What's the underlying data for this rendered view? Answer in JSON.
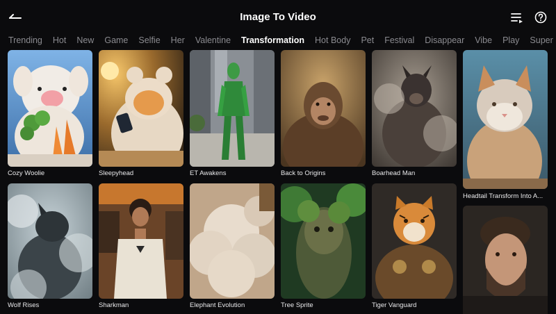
{
  "header": {
    "title": "Image To Video"
  },
  "tabs": [
    {
      "label": "Trending",
      "active": false
    },
    {
      "label": "Hot",
      "active": false
    },
    {
      "label": "New",
      "active": false
    },
    {
      "label": "Game",
      "active": false
    },
    {
      "label": "Selfie",
      "active": false
    },
    {
      "label": "Her",
      "active": false
    },
    {
      "label": "Valentine",
      "active": false
    },
    {
      "label": "Transformation",
      "active": true
    },
    {
      "label": "Hot Body",
      "active": false
    },
    {
      "label": "Pet",
      "active": false
    },
    {
      "label": "Festival",
      "active": false
    },
    {
      "label": "Disappear",
      "active": false
    },
    {
      "label": "Vibe",
      "active": false
    },
    {
      "label": "Play",
      "active": false
    },
    {
      "label": "Super Hero",
      "active": false
    }
  ],
  "cards": [
    {
      "name": "Cozy Woolie"
    },
    {
      "name": "Sleepyhead"
    },
    {
      "name": "ET Awakens"
    },
    {
      "name": "Back to Origins"
    },
    {
      "name": "Boarhead Man"
    },
    {
      "name": "Headtail Transform Into A..."
    },
    {
      "name": "Wolf Rises"
    },
    {
      "name": "Sharkman"
    },
    {
      "name": "Elephant Evolution"
    },
    {
      "name": "Tree Sprite"
    },
    {
      "name": "Tiger Vanguard"
    },
    {
      "name": ""
    }
  ],
  "icons": {
    "back": "back-arrow-icon",
    "list": "list-icon",
    "help": "help-icon"
  },
  "colors": {
    "background": "#0b0b0d",
    "tab_inactive": "#8b8b90",
    "tab_active": "#ffffff"
  }
}
